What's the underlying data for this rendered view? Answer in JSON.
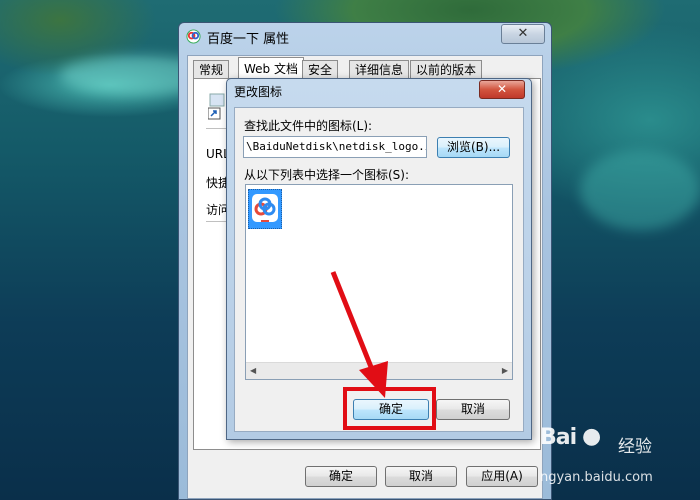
{
  "properties_window": {
    "title": "百度一下 属性",
    "close_glyph": "✕",
    "tabs": [
      {
        "label": "常规",
        "active": false
      },
      {
        "label": "Web 文档",
        "active": true
      },
      {
        "label": "安全",
        "active": false
      },
      {
        "label": "详细信息",
        "active": false
      },
      {
        "label": "以前的版本",
        "active": false
      }
    ],
    "panel_labels": [
      "URL",
      "快捷",
      "访问"
    ],
    "buttons": {
      "ok": "确定",
      "cancel": "取消",
      "apply": "应用(A)"
    }
  },
  "change_icon_dialog": {
    "title": "更改图标",
    "close_glyph": "✕",
    "lookup_label": "查找此文件中的图标(L):",
    "path_value": "\\BaiduNetdisk\\netdisk_logo.ico",
    "browse_label": "浏览(B)...",
    "select_label": "从以下列表中选择一个图标(S):",
    "icon_items": [
      {
        "icon": "baidu-netdisk-icon",
        "selected": true
      }
    ],
    "ok_label": "确定",
    "cancel_label": "取消"
  },
  "annotation": {
    "color": "#e10d15",
    "target": "ok-button"
  },
  "watermark": {
    "logo": "Bai",
    "logo_suffix": "经验",
    "url": "ngyan.baidu.com"
  },
  "colors": {
    "accent": "#3399ff",
    "annotation": "#e10d15"
  }
}
